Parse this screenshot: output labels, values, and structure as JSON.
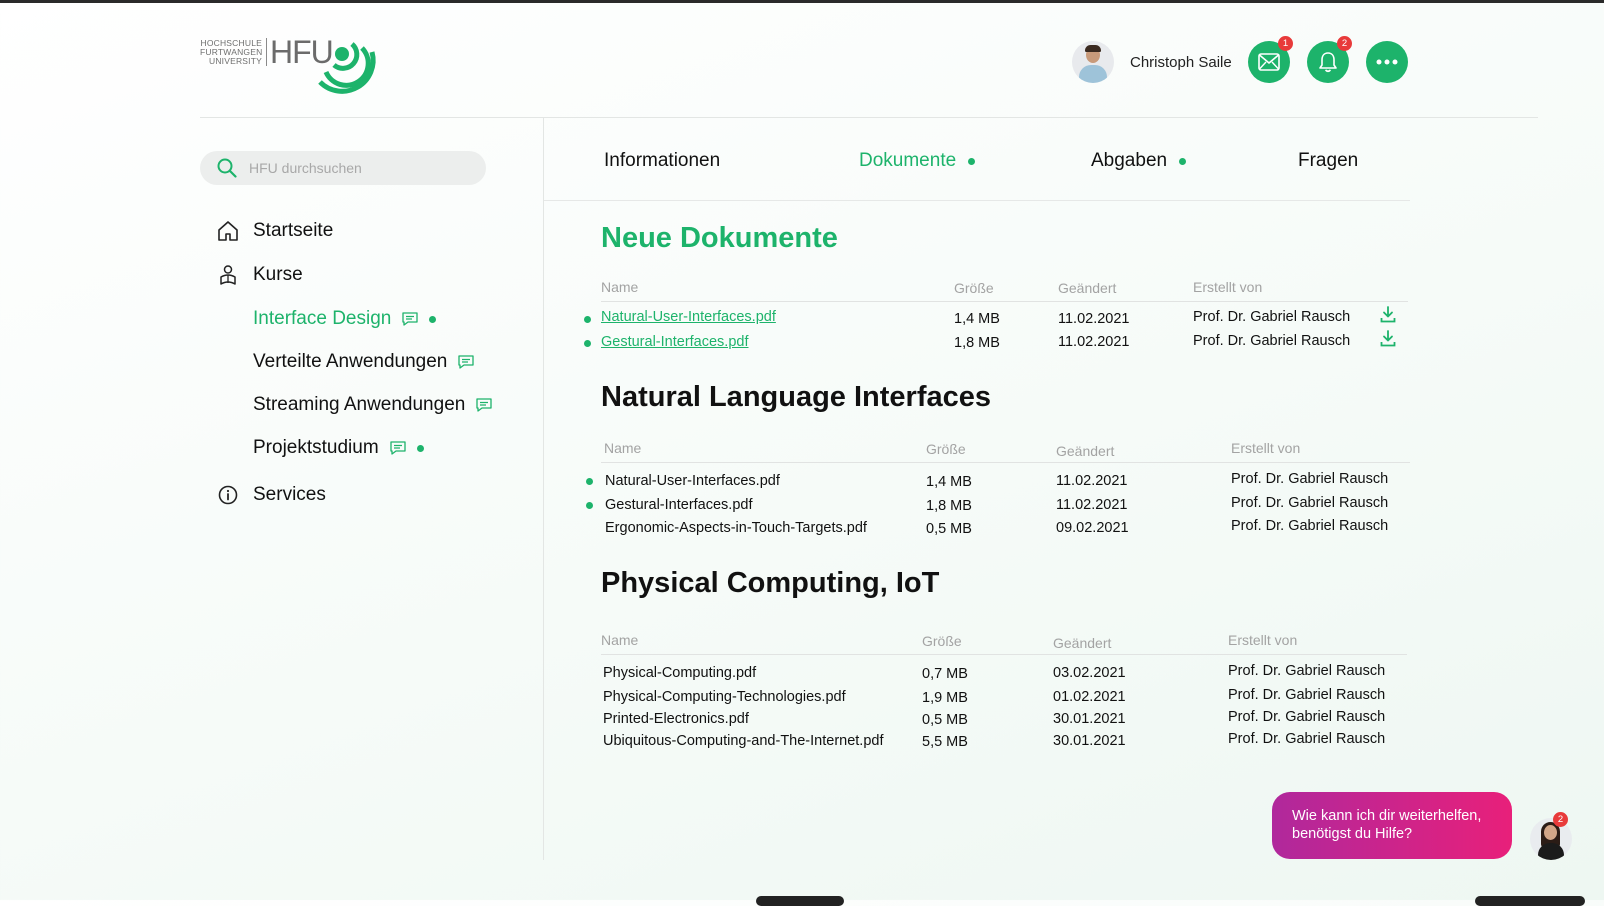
{
  "brand": {
    "small_line1": "HOCHSCHULE",
    "small_line2": "FURTWANGEN",
    "small_line3": "UNIVERSITY",
    "name": "HFU",
    "accent": "#1db36b"
  },
  "header": {
    "user_name": "Christoph Saile",
    "mail_badge": "1",
    "bell_badge": "2",
    "icons": [
      "mail-icon",
      "bell-icon",
      "more-icon"
    ]
  },
  "search": {
    "placeholder": "HFU durchsuchen"
  },
  "sidebar": {
    "items": [
      {
        "label": "Startseite",
        "icon": "home-icon"
      },
      {
        "label": "Kurse",
        "icon": "courses-icon"
      },
      {
        "label": "Services",
        "icon": "info-icon"
      }
    ],
    "courses": [
      {
        "label": "Interface Design",
        "active": true,
        "new": true
      },
      {
        "label": "Verteilte Anwendungen",
        "active": false,
        "new": false
      },
      {
        "label": "Streaming Anwendungen",
        "active": false,
        "new": false
      },
      {
        "label": "Projektstudium",
        "active": false,
        "new": true
      }
    ]
  },
  "tabs": [
    {
      "label": "Informationen",
      "active": false,
      "new": false
    },
    {
      "label": "Dokumente",
      "active": true,
      "new": true
    },
    {
      "label": "Abgaben",
      "active": false,
      "new": true
    },
    {
      "label": "Fragen",
      "active": false,
      "new": false
    }
  ],
  "columns": {
    "name": "Name",
    "size": "Größe",
    "changed": "Geändert",
    "author": "Erstellt von"
  },
  "sections": [
    {
      "title": "Neue Dokumente",
      "rows": [
        {
          "name": "Natural-User-Interfaces.pdf",
          "size": "1,4 MB",
          "changed": "11.02.2021",
          "author": "Prof. Dr. Gabriel Rausch"
        },
        {
          "name": "Gestural-Interfaces.pdf",
          "size": "1,8 MB",
          "changed": "11.02.2021",
          "author": "Prof. Dr. Gabriel Rausch"
        }
      ]
    },
    {
      "title": "Natural Language Interfaces",
      "rows": [
        {
          "name": "Natural-User-Interfaces.pdf",
          "size": "1,4 MB",
          "changed": "11.02.2021",
          "author": "Prof. Dr. Gabriel Rausch"
        },
        {
          "name": "Gestural-Interfaces.pdf",
          "size": "1,8 MB",
          "changed": "11.02.2021",
          "author": "Prof. Dr. Gabriel Rausch"
        },
        {
          "name": "Ergonomic-Aspects-in-Touch-Targets.pdf",
          "size": "0,5 MB",
          "changed": "09.02.2021",
          "author": "Prof. Dr. Gabriel Rausch"
        }
      ]
    },
    {
      "title": "Physical Computing, IoT",
      "rows": [
        {
          "name": "Physical-Computing.pdf",
          "size": "0,7 MB",
          "changed": "03.02.2021",
          "author": "Prof. Dr. Gabriel Rausch"
        },
        {
          "name": "Physical-Computing-Technologies.pdf",
          "size": "1,9 MB",
          "changed": "01.02.2021",
          "author": "Prof. Dr. Gabriel Rausch"
        },
        {
          "name": "Printed-Electronics.pdf",
          "size": "0,5 MB",
          "changed": "30.01.2021",
          "author": "Prof. Dr. Gabriel Rausch"
        },
        {
          "name": "Ubiquitous-Computing-and-The-Internet.pdf",
          "size": "5,5 MB",
          "changed": "30.01.2021",
          "author": "Prof. Dr. Gabriel Rausch"
        }
      ]
    }
  ],
  "assistant": {
    "message_line1": "Wie kann ich dir weiterhelfen,",
    "message_line2": "benötigst du Hilfe?",
    "badge": "2"
  }
}
